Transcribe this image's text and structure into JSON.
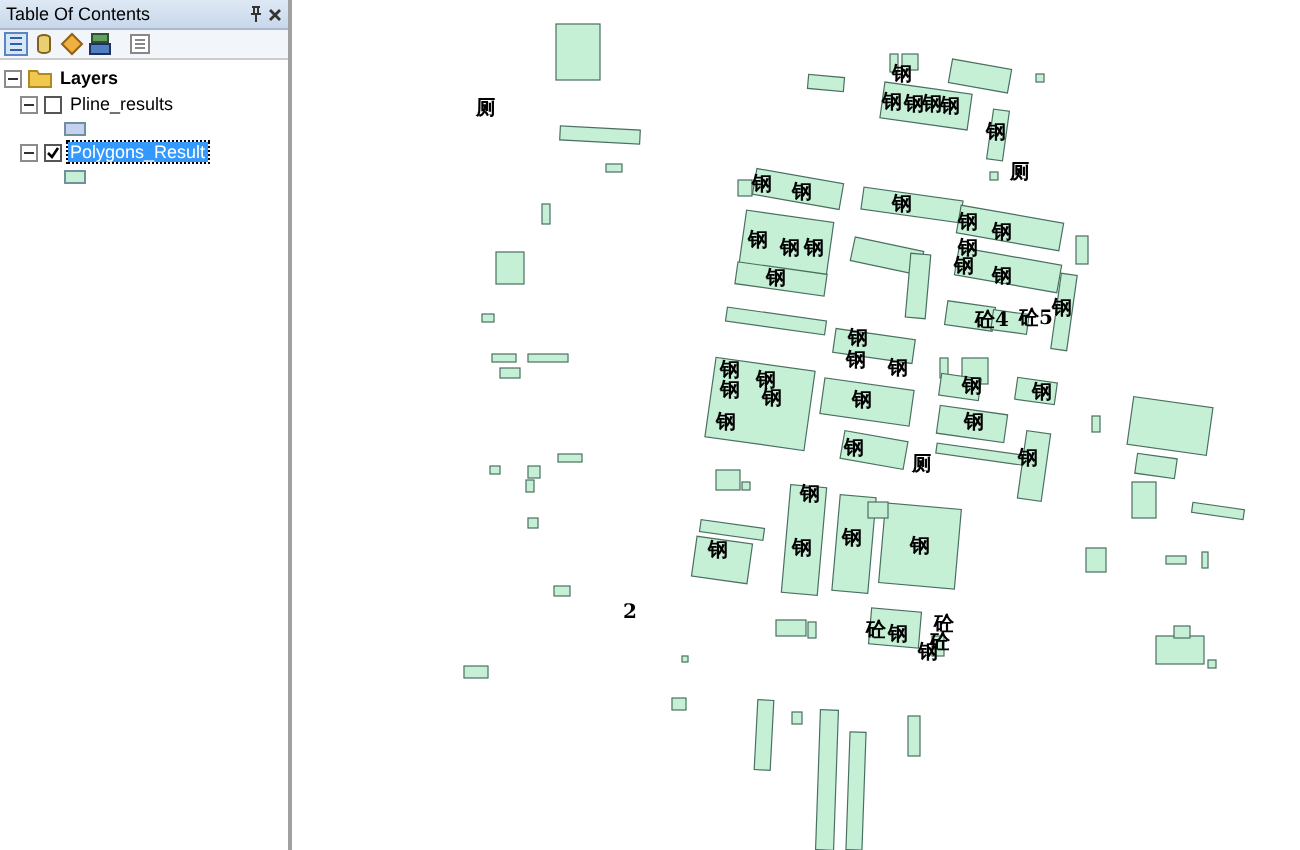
{
  "toc": {
    "title": "Table Of Contents",
    "layers": {
      "label": "Layers",
      "expanded": true,
      "children": [
        {
          "label": "Pline_results",
          "checked": false,
          "selected": false,
          "expanded": true,
          "color": "#c8d0f0"
        },
        {
          "label": "Polygons_Result",
          "checked": true,
          "selected": true,
          "expanded": true,
          "color": "#c6f0d6"
        }
      ]
    }
  },
  "map": {
    "labels": [
      {
        "text": "厕"
      },
      {
        "text": "钢"
      },
      {
        "text": "钢"
      },
      {
        "text": "钢"
      },
      {
        "text": "钢"
      },
      {
        "text": "钢"
      },
      {
        "text": "钢"
      },
      {
        "text": "厕"
      },
      {
        "text": "钢"
      },
      {
        "text": "钢"
      },
      {
        "text": "钢"
      },
      {
        "text": "钢"
      },
      {
        "text": "钢"
      },
      {
        "text": "钢"
      },
      {
        "text": "钢"
      },
      {
        "text": "钢"
      },
      {
        "text": "钢"
      },
      {
        "text": "钢"
      },
      {
        "text": "钢"
      },
      {
        "text": "钢"
      },
      {
        "text": "砼4"
      },
      {
        "text": "砼5"
      },
      {
        "text": "钢"
      },
      {
        "text": "钢"
      },
      {
        "text": "钢"
      },
      {
        "text": "钢"
      },
      {
        "text": "钢"
      },
      {
        "text": "钢"
      },
      {
        "text": "钢"
      },
      {
        "text": "钢"
      },
      {
        "text": "钢"
      },
      {
        "text": "钢"
      },
      {
        "text": "钢"
      },
      {
        "text": "钢"
      },
      {
        "text": "钢"
      },
      {
        "text": "钢"
      },
      {
        "text": "厕"
      },
      {
        "text": "钢"
      },
      {
        "text": "钢"
      },
      {
        "text": "钢"
      },
      {
        "text": "钢"
      },
      {
        "text": "钢"
      },
      {
        "text": "钢"
      },
      {
        "text": "砼"
      },
      {
        "text": "钢"
      },
      {
        "text": "砼"
      },
      {
        "text": "砼"
      },
      {
        "text": "钢"
      },
      {
        "text": "2"
      }
    ]
  }
}
